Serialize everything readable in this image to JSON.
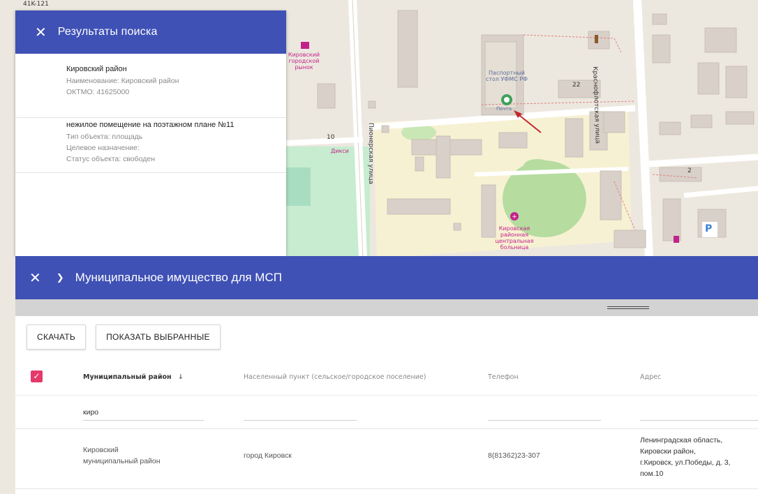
{
  "map": {
    "labels": {
      "house_number": "41K-121",
      "market": "Кировский городской рынок",
      "passport_office": "Паспортный стол УФМС РФ",
      "building_22": "22",
      "street_krasnoflotskaya": "Краснофлотская улица",
      "building_10": "10",
      "diksi": "Дикси",
      "street_pionerskaya": "Пионерская улица",
      "building_2": "2",
      "hospital": "Кировская районная центральная больница",
      "parking": "P",
      "poi_short": "Почта"
    }
  },
  "search_panel": {
    "title": "Результаты поиска",
    "results": [
      {
        "title": "Кировский район",
        "lines": [
          "Наименование: Кировский район",
          "ОКТМО: 41625000"
        ]
      },
      {
        "title": "нежилое помещение на поэтажном плане №11",
        "lines": [
          "Тип объекта: площадь",
          "Целевое назначение:",
          "Статус объекта: свободен"
        ]
      }
    ]
  },
  "data_panel": {
    "title": "Муниципальное имущество для МСП",
    "buttons": {
      "download": "СКАЧАТЬ",
      "show_selected": "ПОКАЗАТЬ ВЫБРАННЫЕ"
    },
    "columns": {
      "district": "Муниципальный район",
      "settlement": "Населенный пункт (сельское/городское поселение)",
      "phone": "Телефон",
      "address": "Адрес"
    },
    "sort_icon": "arrow-down",
    "filters": {
      "district": "киро"
    },
    "rows": [
      {
        "district_line1": "Кировский",
        "district_line2": "муниципальный район",
        "settlement": "город Кировск",
        "phone": "8(81362)23-307",
        "address_lines": [
          "Ленинградская область,",
          "Кировски район,",
          "г.Кировск, ул.Победы, д. 3,",
          "пом.10"
        ]
      }
    ]
  },
  "colors": {
    "header": "#3f51b5",
    "checkbox": "#e5396a"
  }
}
